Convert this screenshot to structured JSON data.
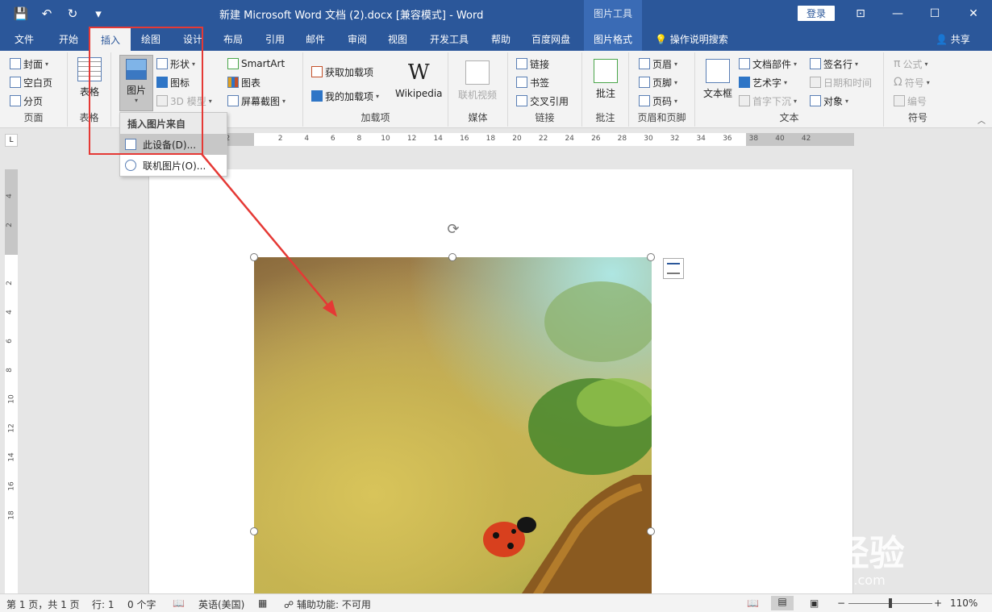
{
  "titlebar": {
    "title": "新建 Microsoft Word 文档 (2).docx [兼容模式]  -  Word",
    "context_header": "图片工具",
    "login": "登录",
    "minimize_glyph": "—",
    "restore_glyph": "☐",
    "close_glyph": "✕",
    "ribbon_display_glyph": "⊡",
    "save_glyph": "💾",
    "undo_glyph": "↶",
    "redo_glyph": "↻",
    "qat_more_glyph": "▾"
  },
  "tabs": [
    "文件",
    "开始",
    "插入",
    "绘图",
    "设计",
    "布局",
    "引用",
    "邮件",
    "审阅",
    "视图",
    "开发工具",
    "帮助",
    "百度网盘",
    "图片格式"
  ],
  "active_tab": "插入",
  "help_search": "操作说明搜索",
  "share": "共享",
  "ribbon": {
    "pages": {
      "label": "页面",
      "cover": "封面",
      "blank": "空白页",
      "break": "分页"
    },
    "tables": {
      "label": "表格",
      "table": "表格"
    },
    "illustrations": {
      "picture": "图片",
      "shapes": "形状",
      "icons": "图标",
      "model3d": "3D 模型",
      "smartart": "SmartArt",
      "chart": "图表",
      "screenshot": "屏幕截图"
    },
    "addins": {
      "label": "加载项",
      "get": "获取加载项",
      "my": "我的加载项",
      "wikipedia": "Wikipedia"
    },
    "media": {
      "label": "媒体",
      "online_video": "联机视频"
    },
    "links": {
      "label": "链接",
      "link": "链接",
      "bookmark": "书签",
      "crossref": "交叉引用"
    },
    "comments": {
      "label": "批注",
      "comment": "批注"
    },
    "header_footer": {
      "label": "页眉和页脚",
      "header": "页眉",
      "footer": "页脚",
      "page_number": "页码"
    },
    "text": {
      "label": "文本",
      "textbox": "文本框",
      "quick_parts": "文档部件",
      "wordart": "艺术字",
      "dropcap": "首字下沉",
      "signature": "签名行",
      "datetime": "日期和时间",
      "object": "对象"
    },
    "symbols": {
      "label": "符号",
      "equation": "公式",
      "symbol": "符号",
      "number": "编号"
    }
  },
  "dropdown": {
    "header": "插入图片来自",
    "item1": "此设备(D)...",
    "item2": "联机图片(O)..."
  },
  "ruler": {
    "h_numbers": [
      "4",
      "2",
      "2",
      "4",
      "6",
      "8",
      "10",
      "12",
      "14",
      "16",
      "18",
      "20",
      "22",
      "24",
      "26",
      "28",
      "30",
      "32",
      "34",
      "36",
      "38",
      "40",
      "42"
    ],
    "v_numbers": [
      "4",
      "2",
      "2",
      "4",
      "6",
      "8",
      "10",
      "12",
      "14",
      "16",
      "18"
    ],
    "corner": "L"
  },
  "status": {
    "page": "第 1 页，共 1 页",
    "line": "行: 1",
    "words": "0 个字",
    "language": "英语(美国)",
    "accessibility": "辅助功能: 不可用",
    "zoom": "110%",
    "zoom_fraction": 0.5,
    "zoom_minus": "−",
    "zoom_plus": "+"
  },
  "watermark": {
    "main": "Bai 经验",
    "sub": "jingyan.baidu.com"
  },
  "colors": {
    "brand": "#2b579a",
    "annotation": "#e53935"
  }
}
